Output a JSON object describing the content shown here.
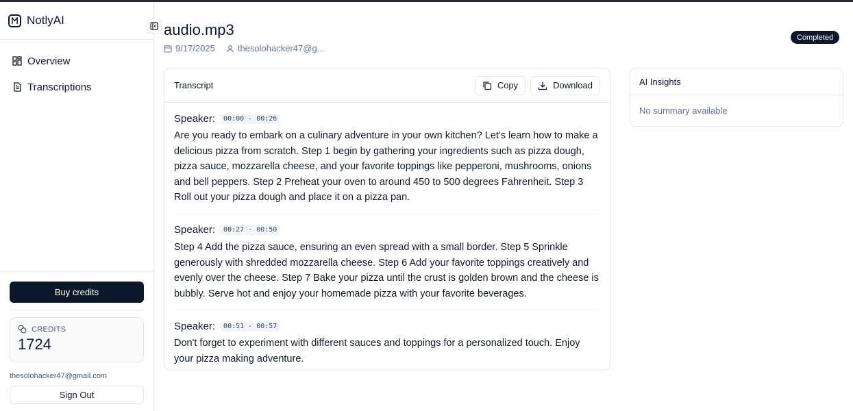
{
  "app": {
    "name": "NotlyAI"
  },
  "sidebar": {
    "items": [
      {
        "label": "Overview",
        "icon": "dashboard-icon"
      },
      {
        "label": "Transcriptions",
        "icon": "file-text-icon"
      }
    ],
    "buy_credits_label": "Buy credits",
    "credits_label": "CREDITS",
    "credits_value": "1724",
    "user_email": "thesolohacker47@gmail.com",
    "sign_out_label": "Sign Out"
  },
  "file": {
    "title": "audio.mp3",
    "date": "9/17/2025",
    "user": "thesolohacker47@g...",
    "status": "Completed"
  },
  "transcript": {
    "title": "Transcript",
    "copy_label": "Copy",
    "download_label": "Download",
    "segments": [
      {
        "speaker": "Speaker:",
        "time": "00:00 - 00:26",
        "text": "Are you ready to embark on a culinary adventure in your own kitchen? Let's learn how to make a delicious pizza from scratch. Step 1 begin by gathering your ingredients such as pizza dough, pizza sauce, mozzarella cheese, and your favorite toppings like pepperoni, mushrooms, onions and bell peppers. Step 2 Preheat your oven to around 450 to 500 degrees Fahrenheit. Step 3 Roll out your pizza dough and place it on a pizza pan."
      },
      {
        "speaker": "Speaker:",
        "time": "00:27 - 00:50",
        "text": "Step 4 Add the pizza sauce, ensuring an even spread with a small border. Step 5 Sprinkle generously with shredded mozzarella cheese. Step 6 Add your favorite toppings creatively and evenly over the cheese. Step 7 Bake your pizza until the crust is golden brown and the cheese is bubbly. Serve hot and enjoy your homemade pizza with your favorite beverages."
      },
      {
        "speaker": "Speaker:",
        "time": "00:51 - 00:57",
        "text": "Don't forget to experiment with different sauces and toppings for a personalized touch. Enjoy your pizza making adventure."
      }
    ]
  },
  "insights": {
    "title": "AI Insights",
    "empty_text": "No summary available"
  },
  "colors": {
    "primary": "#0f172a",
    "border": "#e5e7eb",
    "muted_text": "#64748b"
  }
}
